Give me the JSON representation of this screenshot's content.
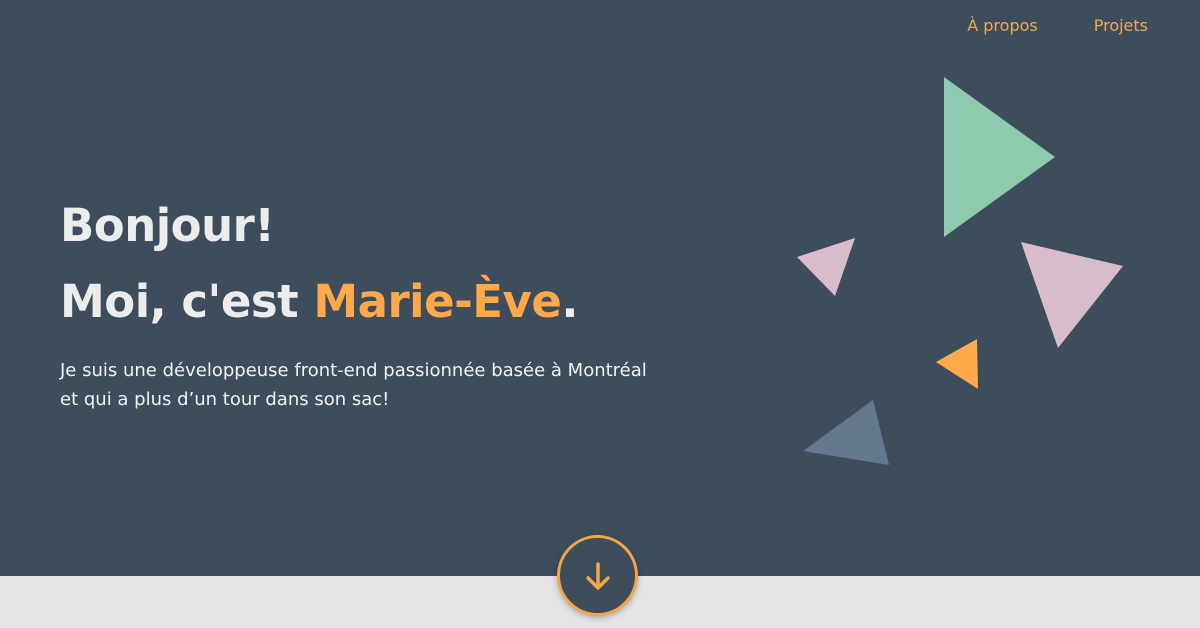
{
  "nav": {
    "items": [
      {
        "label": "À propos"
      },
      {
        "label": "Projets"
      }
    ]
  },
  "hero": {
    "greeting": "Bonjour!",
    "intro_prefix": "Moi, c'est ",
    "name": "Marie-Ève",
    "intro_suffix": ".",
    "description_line1": "Je suis une développeuse front-end passionnée basée à Montréal",
    "description_line2": "et qui a plus d’un tour dans son sac!"
  },
  "scroll_button": {
    "icon": "arrow-down-icon"
  },
  "colors": {
    "background": "#3d4d5c",
    "accent": "#ffa94a",
    "nav_link": "#f0a952",
    "heading": "#ececec",
    "bottom_band": "#e4e4e4",
    "triangle_green": "#8ecaae",
    "triangle_pink": "#d8bccb",
    "triangle_orange": "#ffa94a",
    "triangle_slate": "#64788e"
  }
}
